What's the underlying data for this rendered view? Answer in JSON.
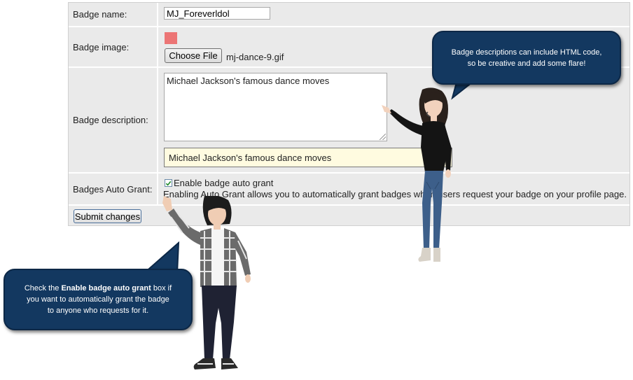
{
  "form": {
    "badge_name_label": "Badge name:",
    "badge_name_value": "MJ_Foreverldol",
    "badge_image_label": "Badge image:",
    "choose_file_label": "Choose File",
    "file_name": "mj-dance-9.gif",
    "badge_description_label": "Badge description:",
    "description_value": "Michael Jackson's famous dance moves",
    "description_preview": "Michael Jackson's famous dance moves",
    "auto_grant_label": "Badges Auto Grant:",
    "auto_grant_checkbox_label": "Enable badge auto grant",
    "auto_grant_checked": true,
    "auto_grant_help": "Enabling Auto Grant allows you to automatically grant badges when users request your badge on your profile page.",
    "submit_label": "Submit changes"
  },
  "callouts": {
    "top_right": {
      "line1": "Badge descriptions can include HTML code,",
      "line2": "so be creative and add some flare!"
    },
    "bottom_left": {
      "line1_prefix": "Check the ",
      "line1_bold": "Enable badge auto grant",
      "line1_suffix": " box if",
      "line2": "you want to automatically grant the badge",
      "line3": "to anyone who requests for it."
    }
  },
  "colors": {
    "panel_bg": "#eaeaea",
    "bubble_bg": "#133860",
    "thumbnail": "#ec7575",
    "preview_bg": "#fffbe0"
  }
}
